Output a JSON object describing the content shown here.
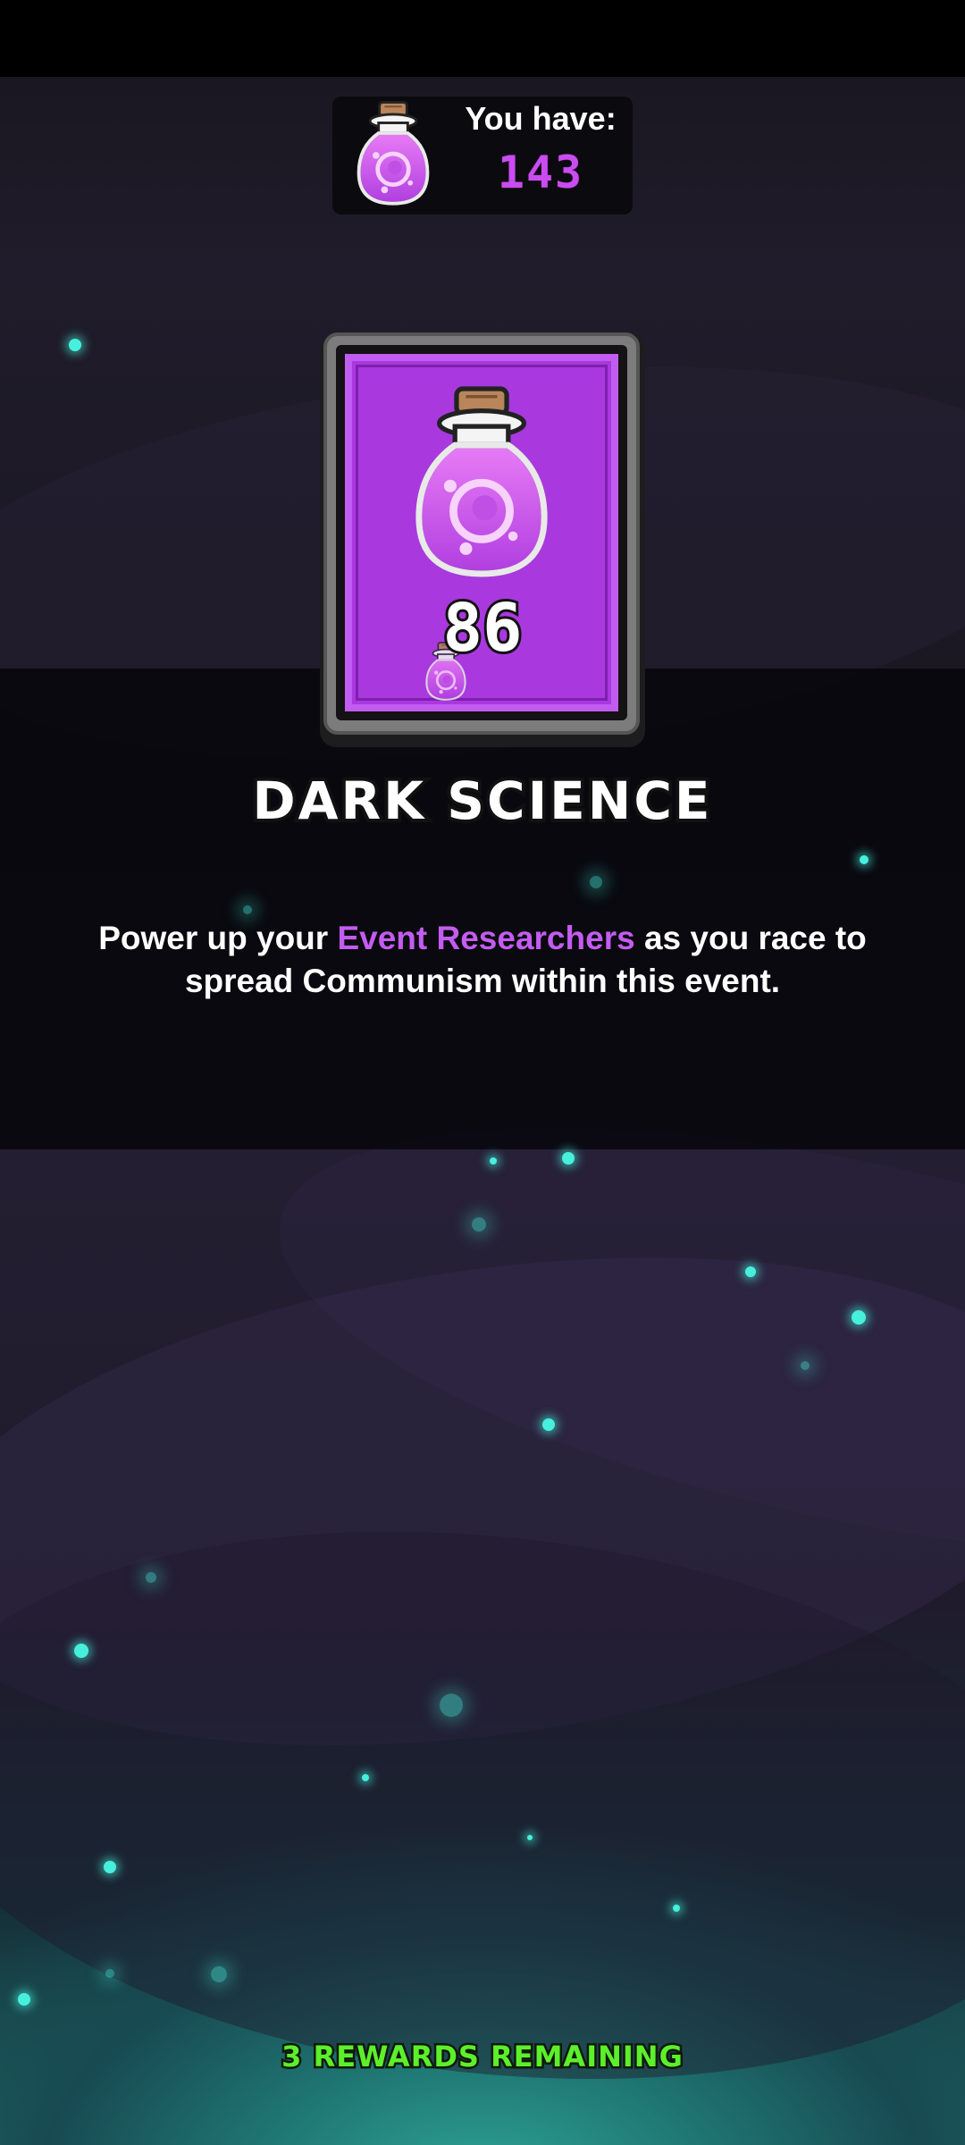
{
  "currency": {
    "label": "You have:",
    "amount": "143",
    "icon": "purple-potion-flask-icon"
  },
  "card": {
    "count": "86",
    "icon": "purple-potion-flask-icon",
    "frame_color": "#a938df"
  },
  "title": "DARK SCIENCE",
  "description": {
    "before": "Power up your ",
    "highlight": "Event Researchers",
    "after": " as you race to spread Communism within this event."
  },
  "footer": {
    "rewards_remaining": "3 REWARDS REMAINING"
  },
  "colors": {
    "accent_purple": "#c35cf0",
    "particle_teal": "#46f0dc",
    "rewards_green": "#5cf02a"
  }
}
